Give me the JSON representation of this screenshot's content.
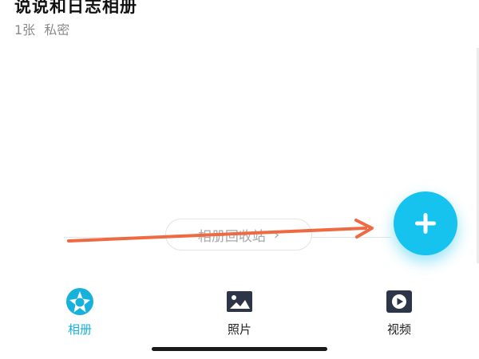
{
  "album": {
    "title": "说说和日志相册",
    "count": "1张",
    "privacy": "私密"
  },
  "recycle_bin": {
    "label": "相册回收站",
    "chevron": "›"
  },
  "fab": {
    "icon": "plus-icon"
  },
  "tabs": [
    {
      "label": "相册",
      "icon": "album-shutter-icon",
      "active": true
    },
    {
      "label": "照片",
      "icon": "photo-icon",
      "active": false
    },
    {
      "label": "视频",
      "icon": "video-icon",
      "active": false
    }
  ],
  "colors": {
    "accent": "#16c2ee",
    "active_tab": "#16b2dc",
    "annotation_arrow": "#ef6a43"
  }
}
